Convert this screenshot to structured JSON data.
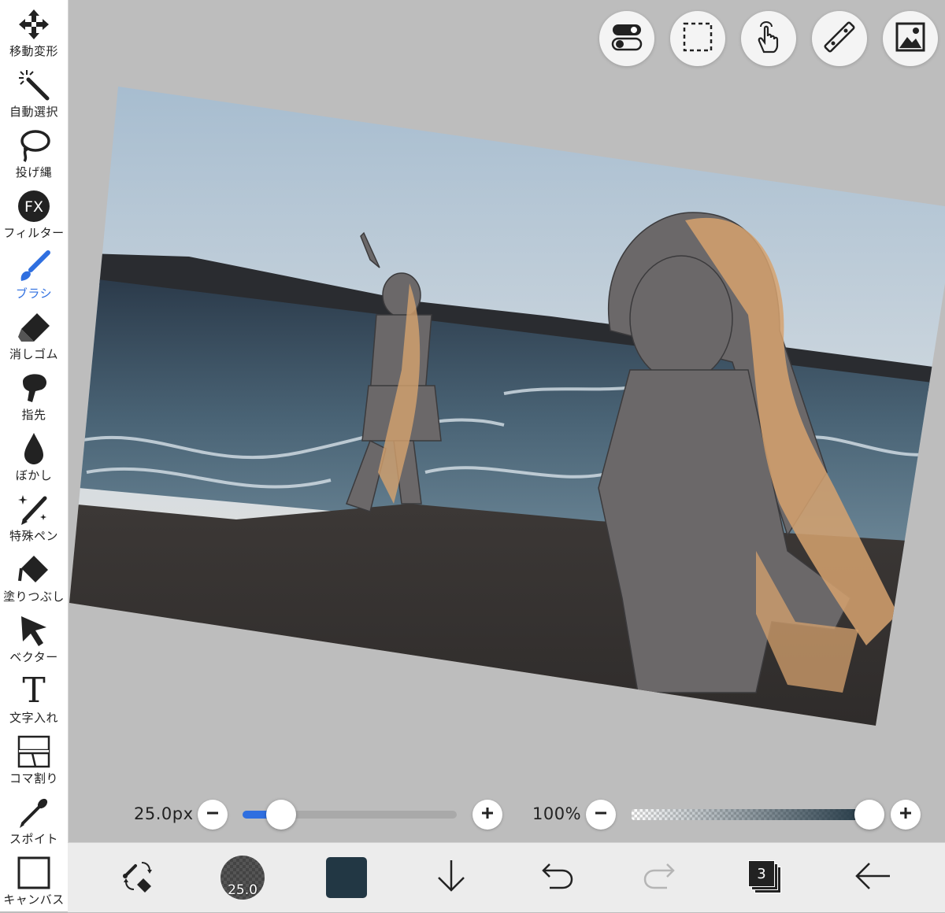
{
  "toolbar": {
    "items": [
      {
        "label": "移動変形",
        "icon": "move-arrows-icon"
      },
      {
        "label": "自動選択",
        "icon": "magic-wand-icon"
      },
      {
        "label": "投げ縄",
        "icon": "lasso-icon"
      },
      {
        "label": "フィルター",
        "icon": "fx-icon",
        "icon_text": "FX"
      },
      {
        "label": "ブラシ",
        "icon": "brush-icon",
        "active": true
      },
      {
        "label": "消しゴム",
        "icon": "eraser-icon"
      },
      {
        "label": "指先",
        "icon": "finger-smudge-icon"
      },
      {
        "label": "ぼかし",
        "icon": "blur-drop-icon"
      },
      {
        "label": "特殊ペン",
        "icon": "special-pen-icon"
      },
      {
        "label": "塗りつぶし",
        "icon": "bucket-fill-icon"
      },
      {
        "label": "ベクター",
        "icon": "vector-cursor-icon"
      },
      {
        "label": "文字入れ",
        "icon": "text-icon",
        "icon_text": "T"
      },
      {
        "label": "コマ割り",
        "icon": "panel-layout-icon"
      },
      {
        "label": "スポイト",
        "icon": "eyedropper-icon"
      },
      {
        "label": "キャンバス",
        "icon": "canvas-icon"
      }
    ],
    "active_color": "#2f6fe0"
  },
  "quick_buttons": [
    "toggle-icon",
    "selection-icon",
    "touch-gesture-icon",
    "ruler-icon",
    "image-icon"
  ],
  "brush_size": {
    "value_label": "25.0px",
    "fraction": 0.18
  },
  "opacity": {
    "value_label": "100%",
    "fraction": 1.0
  },
  "bottom": {
    "brush_size_badge": "25.0",
    "current_color": "#223744",
    "layer_count": "3",
    "icons": [
      "swap-brush-eraser-icon",
      "brush-size-icon",
      "color-swatch-icon",
      "download-arrow-icon",
      "undo-icon",
      "redo-icon",
      "layers-icon",
      "back-arrow-icon"
    ]
  },
  "colors": {
    "accent": "#2f6fe0",
    "canvas_bg": "#bdbdbd"
  }
}
